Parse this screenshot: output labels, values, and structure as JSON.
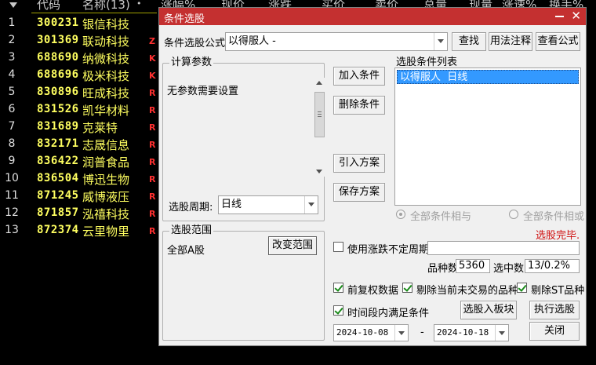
{
  "stock_list": {
    "headers": {
      "code": "代码",
      "name": "名称(13)",
      "dot": "•",
      "change_pct": "涨幅%",
      "price": "现价",
      "change": "涨跌",
      "bid": "买价",
      "ask": "卖价",
      "volume": "总量",
      "cur_volume": "现量",
      "speed": "涨速%",
      "turnover": "换手%"
    },
    "rows": [
      {
        "idx": "1",
        "code": "300231",
        "name": "银信科技",
        "flag": ""
      },
      {
        "idx": "2",
        "code": "301369",
        "name": "联动科技",
        "flag": "Z"
      },
      {
        "idx": "3",
        "code": "688690",
        "name": "纳微科技",
        "flag": "K"
      },
      {
        "idx": "4",
        "code": "688696",
        "name": "极米科技",
        "flag": "K"
      },
      {
        "idx": "5",
        "code": "830896",
        "name": "旺成科技",
        "flag": "R"
      },
      {
        "idx": "6",
        "code": "831526",
        "name": "凯华材料",
        "flag": "R"
      },
      {
        "idx": "7",
        "code": "831689",
        "name": "克莱特",
        "flag": "R"
      },
      {
        "idx": "8",
        "code": "832171",
        "name": "志晟信息",
        "flag": "R"
      },
      {
        "idx": "9",
        "code": "836422",
        "name": "润普食品",
        "flag": "R"
      },
      {
        "idx": "10",
        "code": "836504",
        "name": "博迅生物",
        "flag": "R"
      },
      {
        "idx": "11",
        "code": "871245",
        "name": "威博液压",
        "flag": "R"
      },
      {
        "idx": "12",
        "code": "871857",
        "name": "泓禧科技",
        "flag": "R"
      },
      {
        "idx": "13",
        "code": "872374",
        "name": "云里物里",
        "flag": "R"
      }
    ]
  },
  "dialog": {
    "title": "条件选股",
    "formula_label": "条件选股公式",
    "formula_value": "以得服人     -",
    "search_btn": "查找",
    "usage_btn": "用法注释",
    "view_formula_btn": "查看公式",
    "calc_params_title": "计算参数",
    "no_params_text": "无参数需要设置",
    "add_condition_btn": "加入条件",
    "delete_condition_btn": "删除条件",
    "import_plan_btn": "引入方案",
    "save_plan_btn": "保存方案",
    "condition_list_label": "选股条件列表",
    "condition_items": [
      "以得服人  日线"
    ],
    "period_label": "选股周期:",
    "period_value": "日线",
    "all_and_label": "全部条件相与",
    "all_or_label": "全部条件相或",
    "status_text": "选股完毕.",
    "scope_title": "选股范围",
    "scope_value": "全部A股",
    "change_scope_btn": "改变范围",
    "irregular_period_label": "使用涨跌不定周期",
    "count_label": "品种数",
    "count_value": "5360",
    "selected_label": "选中数",
    "selected_value": "13/0.2%",
    "pre_adjust_label": "前复权数据",
    "exclude_untraded_label": "剔除当前未交易的品种",
    "exclude_st_label": "剔除ST品种",
    "time_range_label": "时间段内满足条件",
    "select_to_block_btn": "选股入板块",
    "execute_btn": "执行选股",
    "date_from": "2024-10-08",
    "date_sep": "-",
    "date_to": "2024-10-18",
    "close_btn": "关闭"
  },
  "colors": {
    "title_bar": "#c43030",
    "code_text": "#ffff60",
    "flag_text": "#ff3030",
    "status_text": "#d01010",
    "list_selection": "#3399ff"
  }
}
